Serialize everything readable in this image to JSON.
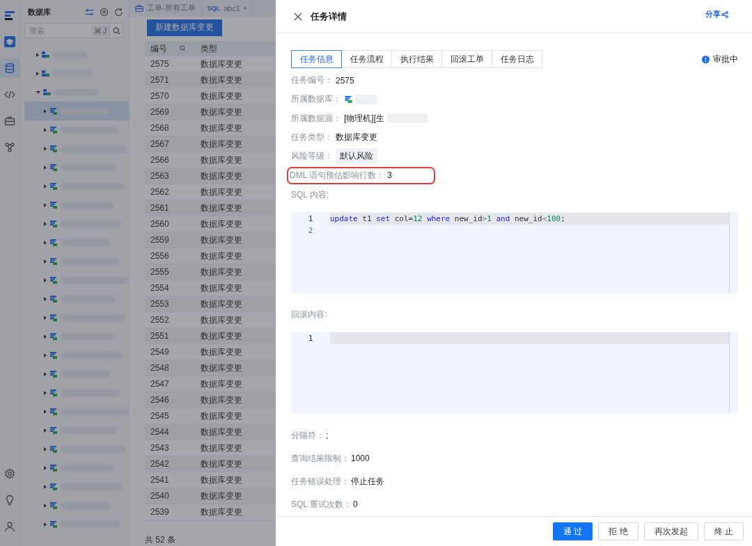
{
  "rail": {
    "top": [
      {
        "kind": "logo",
        "selected": false
      },
      {
        "kind": "layers",
        "selected": false
      },
      {
        "kind": "database",
        "selected": true
      },
      {
        "kind": "code",
        "selected": false
      },
      {
        "kind": "briefcase",
        "selected": false
      },
      {
        "kind": "network",
        "selected": false
      }
    ],
    "bottom": [
      {
        "kind": "settings",
        "selected": false
      },
      {
        "kind": "bulb",
        "selected": false
      },
      {
        "kind": "user",
        "selected": false
      }
    ]
  },
  "tree_panel": {
    "title": "数据库",
    "search": {
      "placeholder": "搜索",
      "shortcut": "⌘ J"
    },
    "items": [
      {
        "expanded": false,
        "selected": false
      },
      {
        "expanded": false,
        "selected": false
      },
      {
        "expanded": true,
        "selected": false,
        "children": [
          {
            "expanded": false,
            "selected": true
          },
          {
            "expanded": false,
            "selected": false
          },
          {
            "expanded": false,
            "selected": false
          },
          {
            "expanded": false,
            "selected": false
          },
          {
            "expanded": false,
            "selected": false
          },
          {
            "expanded": false,
            "selected": false
          },
          {
            "expanded": false,
            "selected": false
          },
          {
            "expanded": false,
            "selected": false
          },
          {
            "expanded": false,
            "selected": false
          },
          {
            "expanded": false,
            "selected": false
          },
          {
            "expanded": false,
            "selected": false
          },
          {
            "expanded": false,
            "selected": false
          },
          {
            "expanded": false,
            "selected": false
          },
          {
            "expanded": false,
            "selected": false
          },
          {
            "expanded": false,
            "selected": false
          },
          {
            "expanded": false,
            "selected": false
          },
          {
            "expanded": false,
            "selected": false
          },
          {
            "expanded": false,
            "selected": false
          },
          {
            "expanded": false,
            "selected": false
          },
          {
            "expanded": false,
            "selected": false
          },
          {
            "expanded": false,
            "selected": false
          },
          {
            "expanded": false,
            "selected": false
          },
          {
            "expanded": false,
            "selected": false
          }
        ]
      }
    ]
  },
  "tabs": [
    {
      "kind": "ticket",
      "label": "工单-所有工单"
    },
    {
      "kind": "sql",
      "badge": "SQL",
      "label": "abc1"
    }
  ],
  "new_button": "新建数据库变更",
  "table": {
    "columns": [
      "编号",
      "类型"
    ],
    "rows": [
      [
        "2575",
        "数据库变更"
      ],
      [
        "2571",
        "数据库变更"
      ],
      [
        "2570",
        "数据库变更"
      ],
      [
        "2569",
        "数据库变更"
      ],
      [
        "2568",
        "数据库变更"
      ],
      [
        "2567",
        "数据库变更"
      ],
      [
        "2566",
        "数据库变更"
      ],
      [
        "2563",
        "数据库变更"
      ],
      [
        "2562",
        "数据库变更"
      ],
      [
        "2561",
        "数据库变更"
      ],
      [
        "2560",
        "数据库变更"
      ],
      [
        "2559",
        "数据库变更"
      ],
      [
        "2556",
        "数据库变更"
      ],
      [
        "2555",
        "数据库变更"
      ],
      [
        "2554",
        "数据库变更"
      ],
      [
        "2553",
        "数据库变更"
      ],
      [
        "2552",
        "数据库变更"
      ],
      [
        "2551",
        "数据库变更"
      ],
      [
        "2549",
        "数据库变更"
      ],
      [
        "2548",
        "数据库变更"
      ],
      [
        "2547",
        "数据库变更"
      ],
      [
        "2546",
        "数据库变更"
      ],
      [
        "2545",
        "数据库变更"
      ],
      [
        "2544",
        "数据库变更"
      ],
      [
        "2543",
        "数据库变更"
      ],
      [
        "2542",
        "数据库变更"
      ],
      [
        "2541",
        "数据库变更"
      ],
      [
        "2540",
        "数据库变更"
      ],
      [
        "2539",
        "数据库变更"
      ]
    ],
    "footer": "共 52 条"
  },
  "drawer": {
    "title": "任务详情",
    "share": "分享",
    "tabs": [
      {
        "label": "任务信息",
        "selected": true
      },
      {
        "label": "任务流程",
        "selected": false
      },
      {
        "label": "执行结果",
        "selected": false
      },
      {
        "label": "回滚工单",
        "selected": false
      },
      {
        "label": "任务日志",
        "selected": false
      }
    ],
    "status": "审批中",
    "fields": [
      {
        "kind": "text",
        "label": "任务编号：",
        "value": "2575",
        "highlighted": false
      },
      {
        "kind": "database",
        "label": "所属数据库：",
        "highlighted": false
      },
      {
        "kind": "source",
        "label": "所属数据源：",
        "value": "[物理机][生",
        "highlighted": false
      },
      {
        "kind": "text",
        "label": "任务类型：",
        "value": "数据库变更",
        "highlighted": false
      },
      {
        "kind": "tag",
        "label": "风险等级：",
        "value": "默认风险",
        "highlighted": false
      },
      {
        "kind": "text",
        "label": "DML 语句预估影响行数：",
        "value": "3",
        "highlighted": true
      }
    ],
    "sql_label": "SQL 内容:",
    "sql_lines": [
      {
        "number": "1",
        "active": true,
        "tokens": [
          {
            "kind": "kw",
            "text": "update"
          },
          {
            "kind": "plain",
            "text": " t1 "
          },
          {
            "kind": "kw",
            "text": "set"
          },
          {
            "kind": "plain",
            "text": " col="
          },
          {
            "kind": "num",
            "text": "12 "
          },
          {
            "kind": "kw",
            "text": "where"
          },
          {
            "kind": "plain",
            "text": " new_id"
          },
          {
            "kind": "op",
            "text": ">"
          },
          {
            "kind": "num",
            "text": "1 "
          },
          {
            "kind": "kw",
            "text": "and"
          },
          {
            "kind": "plain",
            "text": " new_id"
          },
          {
            "kind": "op",
            "text": "<"
          },
          {
            "kind": "num",
            "text": "100"
          },
          {
            "kind": "plain",
            "text": ";"
          }
        ]
      },
      {
        "number": "2",
        "active": false
      }
    ],
    "rollback_label": "回滚内容:",
    "rollback_lines": [
      {
        "number": "1",
        "active": true
      }
    ],
    "more_fields": [
      {
        "label": "分隔符：",
        "value": ";"
      },
      {
        "label": "查询结果限制：",
        "value": "1000"
      },
      {
        "label": "任务错误处理：",
        "value": "停止任务"
      },
      {
        "label": "SQL 重试次数：",
        "value": "0"
      }
    ],
    "buttons": [
      {
        "kind": "primary",
        "label": "通 过"
      },
      {
        "kind": "default",
        "label": "拒 绝"
      },
      {
        "kind": "default",
        "label": "再次发起"
      },
      {
        "kind": "default",
        "label": "终 止"
      }
    ]
  }
}
